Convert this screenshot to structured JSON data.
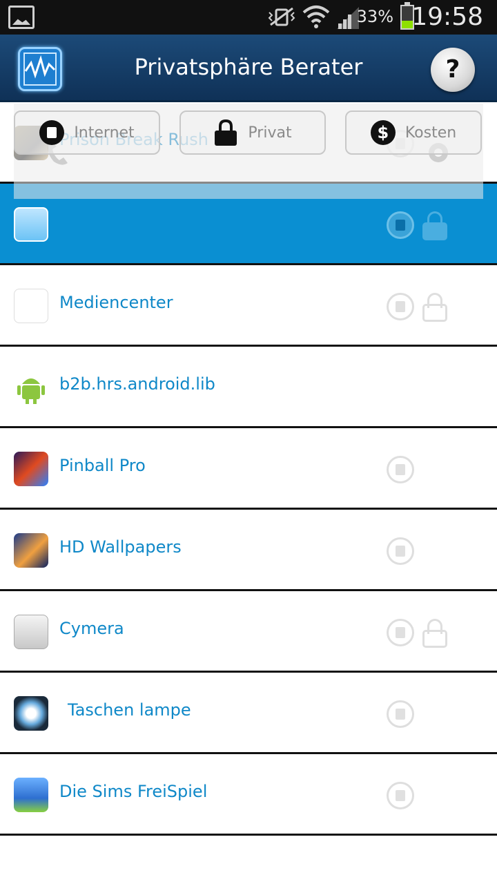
{
  "status_bar": {
    "battery_percent": "33%",
    "battery_level": 0.33,
    "time": "19:58"
  },
  "header": {
    "title": "Privatsphäre Berater",
    "help_label": "?"
  },
  "filters": [
    {
      "label": "Internet",
      "icon": "sim-icon"
    },
    {
      "label": "Privat",
      "icon": "lock-icon"
    },
    {
      "label": "Kosten",
      "icon": "dollar-icon"
    }
  ],
  "apps": [
    {
      "name": "Prison Break Rush",
      "icon": "prison-break-icon",
      "perm_internet": true,
      "perm_private": false,
      "selected": false
    },
    {
      "name": "",
      "icon": "sparkasse-icon",
      "perm_internet": true,
      "perm_private": true,
      "selected": true
    },
    {
      "name": "Mediencenter",
      "icon": "t-mobile-mediencenter-icon",
      "perm_internet": true,
      "perm_private": true,
      "selected": false
    },
    {
      "name": "b2b.hrs.android.lib",
      "icon": "android-icon",
      "perm_internet": false,
      "perm_private": false,
      "selected": false
    },
    {
      "name": "Pinball Pro",
      "icon": "pinball-icon",
      "perm_internet": true,
      "perm_private": false,
      "selected": false
    },
    {
      "name": "HD Wallpapers",
      "icon": "wallpapers-icon",
      "perm_internet": true,
      "perm_private": false,
      "selected": false
    },
    {
      "name": "Cymera",
      "icon": "camera-icon",
      "perm_internet": true,
      "perm_private": true,
      "selected": false
    },
    {
      "name": "Taschen lampe",
      "icon": "flashlight-icon",
      "perm_internet": true,
      "perm_private": false,
      "selected": false
    },
    {
      "name": "Die Sims FreiSpiel",
      "icon": "sims-icon",
      "perm_internet": true,
      "perm_private": false,
      "selected": false
    }
  ]
}
